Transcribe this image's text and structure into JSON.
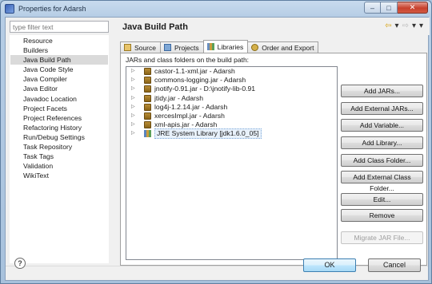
{
  "window": {
    "title": "Properties for Adarsh",
    "minimize": "–",
    "maximize": "□",
    "close": "✕"
  },
  "filter": {
    "placeholder": "type filter text",
    "value": "type filter text"
  },
  "nav": {
    "items": [
      "Resource",
      "Builders",
      "Java Build Path",
      "Java Code Style",
      "Java Compiler",
      "Java Editor",
      "Javadoc Location",
      "Project Facets",
      "Project References",
      "Refactoring History",
      "Run/Debug Settings",
      "Task Repository",
      "Task Tags",
      "Validation",
      "WikiText"
    ],
    "selected": "Java Build Path"
  },
  "header": {
    "title": "Java Build Path",
    "back_icon": "back-arrow-icon",
    "forward_icon": "forward-arrow-icon",
    "menu_icon": "dropdown-menu-icon"
  },
  "tabs": [
    {
      "label": "Source",
      "icon": "source-folder-icon"
    },
    {
      "label": "Projects",
      "icon": "projects-icon"
    },
    {
      "label": "Libraries",
      "icon": "libraries-icon",
      "active": true
    },
    {
      "label": "Order and Export",
      "icon": "order-export-icon"
    }
  ],
  "libraries": {
    "label": "JARs and class folders on the build path:",
    "entries": [
      "castor-1.1-xml.jar - Adarsh",
      "commons-logging.jar - Adarsh",
      "jnotify-0.91.jar - D:\\jnotify-lib-0.91",
      "jtidy.jar - Adarsh",
      "log4j-1.2.14.jar - Adarsh",
      "xercesImpl.jar - Adarsh",
      "xml-apis.jar - Adarsh",
      "JRE System Library [jdk1.6.0_05]"
    ]
  },
  "buttons": {
    "add_jars": "Add JARs...",
    "add_external_jars": "Add External JARs...",
    "add_variable": "Add Variable...",
    "add_library": "Add Library...",
    "add_class_folder": "Add Class Folder...",
    "add_external_class_folder": "Add External Class Folder...",
    "edit": "Edit...",
    "remove": "Remove",
    "migrate": "Migrate JAR File..."
  },
  "footer": {
    "help": "?",
    "ok": "OK",
    "cancel": "Cancel"
  }
}
